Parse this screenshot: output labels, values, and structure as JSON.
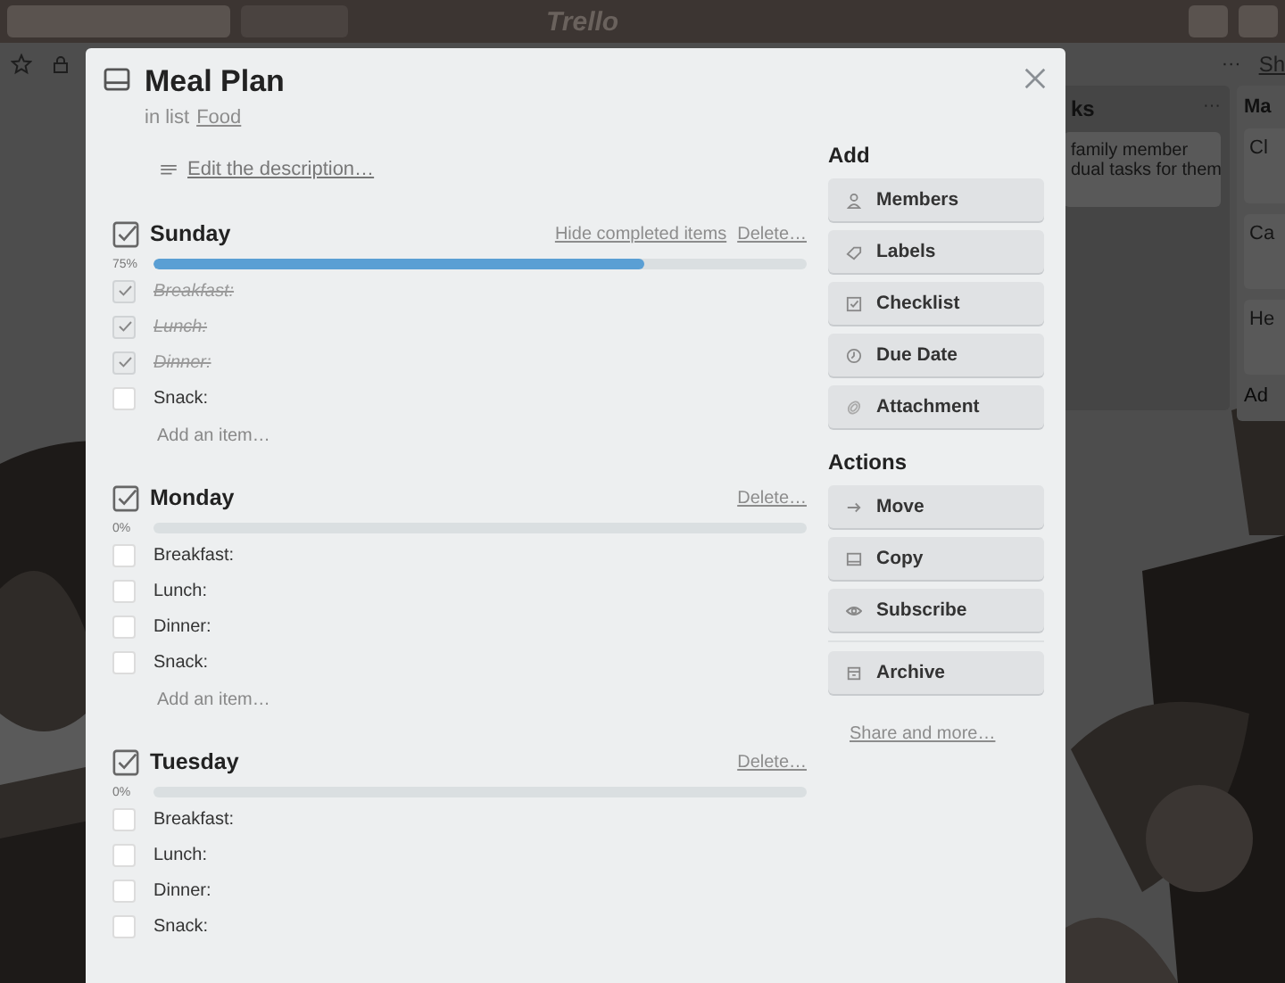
{
  "top_bar": {
    "logo": "Trello"
  },
  "board": {
    "header_link": "Sh",
    "header_menu": "···",
    "lists": [
      {
        "title": "ks",
        "menu": "···",
        "cards": [
          {
            "lines": [
              "family member",
              "dual tasks for them"
            ]
          }
        ]
      },
      {
        "title": "Ma",
        "cards": [
          {
            "lines": [
              "Cl"
            ]
          },
          {
            "lines": [
              "Ca"
            ]
          },
          {
            "lines": [
              "He"
            ]
          }
        ],
        "add": "Ad"
      }
    ]
  },
  "card": {
    "title": "Meal Plan",
    "list_prefix": "in list",
    "list_name": "Food",
    "description_link": "Edit the description…",
    "checklists": [
      {
        "title": "Sunday",
        "hide_completed": "Hide completed items",
        "delete": "Delete…",
        "percent": "75%",
        "level": 0.75,
        "add_item": "Add an item…",
        "items": [
          {
            "text": "Breakfast:",
            "checked": true
          },
          {
            "text": "Lunch:",
            "checked": true
          },
          {
            "text": "Dinner:",
            "checked": true
          },
          {
            "text": "Snack:",
            "checked": false
          }
        ]
      },
      {
        "title": "Monday",
        "delete": "Delete…",
        "percent": "0%",
        "level": 0,
        "add_item": "Add an item…",
        "items": [
          {
            "text": "Breakfast:",
            "checked": false
          },
          {
            "text": "Lunch:",
            "checked": false
          },
          {
            "text": "Dinner:",
            "checked": false
          },
          {
            "text": "Snack:",
            "checked": false
          }
        ]
      },
      {
        "title": "Tuesday",
        "delete": "Delete…",
        "percent": "0%",
        "level": 0,
        "items": [
          {
            "text": "Breakfast:",
            "checked": false
          },
          {
            "text": "Lunch:",
            "checked": false
          },
          {
            "text": "Dinner:",
            "checked": false
          },
          {
            "text": "Snack:",
            "checked": false
          }
        ]
      }
    ],
    "sidebar": {
      "add_heading": "Add",
      "add_buttons": [
        "Members",
        "Labels",
        "Checklist",
        "Due Date",
        "Attachment"
      ],
      "actions_heading": "Actions",
      "action_buttons": [
        "Move",
        "Copy",
        "Subscribe"
      ],
      "archive_button": "Archive",
      "share_link": "Share and more…"
    }
  }
}
